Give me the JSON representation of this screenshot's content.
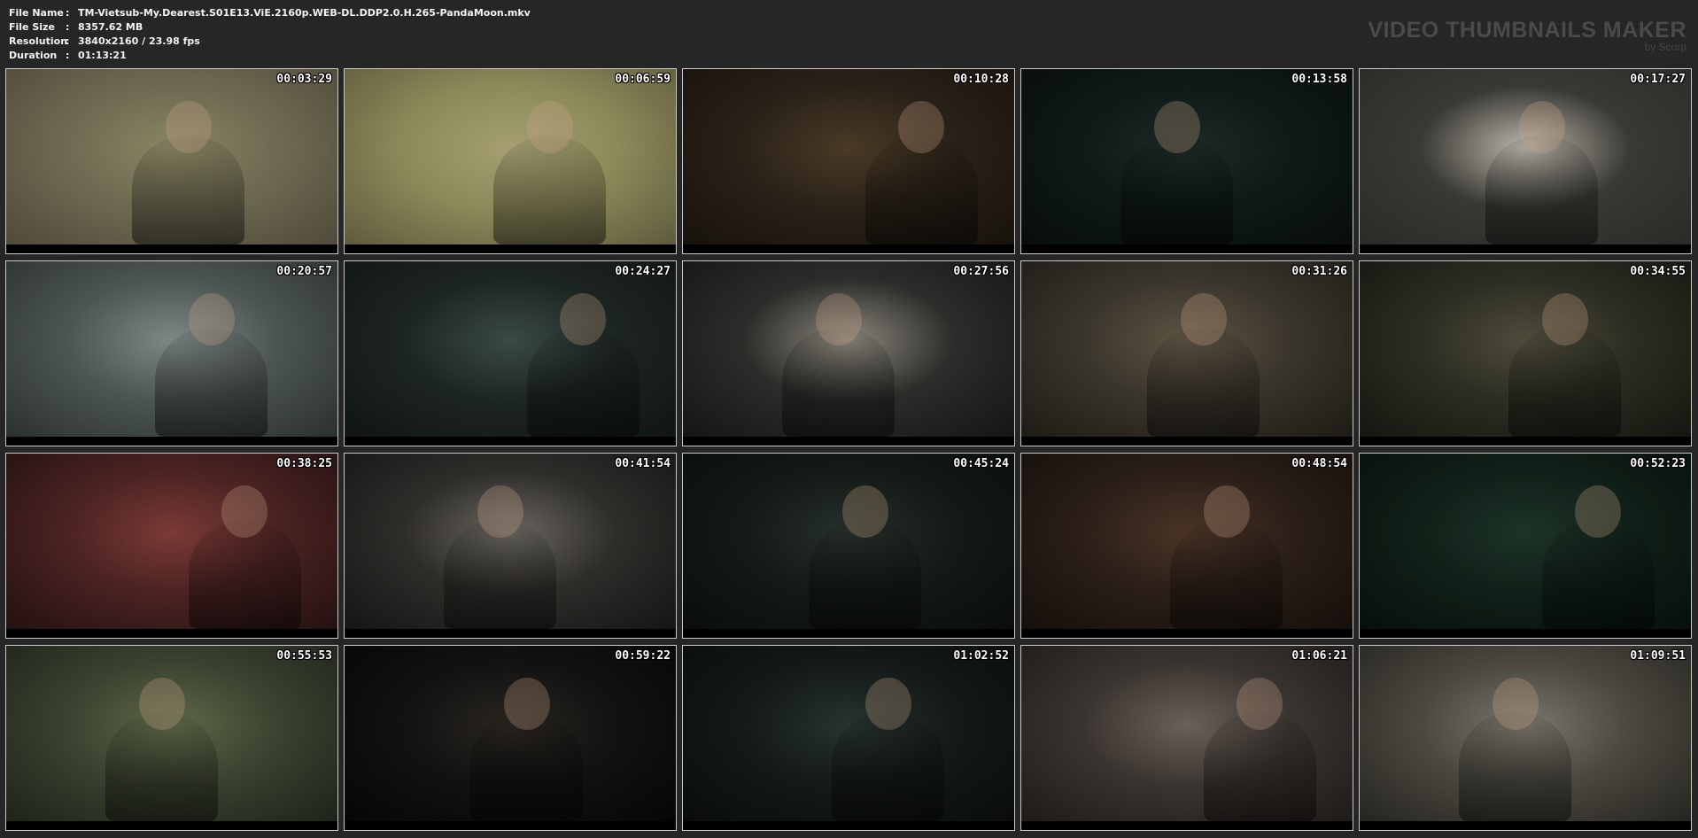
{
  "header": {
    "info": [
      {
        "label": "File Name",
        "value": "TM-Vietsub-My.Dearest.S01E13.ViE.2160p.WEB-DL.DDP2.0.H.265-PandaMoon.mkv"
      },
      {
        "label": "File Size",
        "value": "8357.62 MB"
      },
      {
        "label": "Resolution",
        "value": "3840x2160 / 23.98 fps"
      },
      {
        "label": "Duration",
        "value": "01:13:21"
      }
    ],
    "separator": ":",
    "brand_title": "VIDEO THUMBNAILS MAKER",
    "brand_sub": "by Scorp"
  },
  "thumbnails": [
    {
      "time": "00:03:29",
      "scene": "field-figures",
      "bg": [
        "#6e6a52",
        "#8a8562",
        "#4f4a3a"
      ]
    },
    {
      "time": "00:06:59",
      "scene": "old-man-reeds",
      "bg": [
        "#8d8a5a",
        "#a59f72",
        "#5e5b3d"
      ]
    },
    {
      "time": "00:10:28",
      "scene": "dark-room",
      "bg": [
        "#2a2218",
        "#4a3a26",
        "#17120c"
      ]
    },
    {
      "time": "00:13:58",
      "scene": "man-profile-dark",
      "bg": [
        "#0f1a18",
        "#1d2a26",
        "#080d0c"
      ]
    },
    {
      "time": "00:17:27",
      "scene": "woman-window",
      "bg": [
        "#3a3934",
        "#b9b5aa",
        "#2a2a27"
      ]
    },
    {
      "time": "00:20:57",
      "scene": "scholar-hat-blue",
      "bg": [
        "#4d5553",
        "#7d8784",
        "#2a312f"
      ]
    },
    {
      "time": "00:24:27",
      "scene": "scholar-close",
      "bg": [
        "#1d2522",
        "#3a4a46",
        "#101513"
      ]
    },
    {
      "time": "00:27:56",
      "scene": "black-hat-lattice",
      "bg": [
        "#2c2c2a",
        "#8c877d",
        "#151514"
      ]
    },
    {
      "time": "00:31:26",
      "scene": "woman-earrings",
      "bg": [
        "#3a352c",
        "#5f5343",
        "#1e1b16"
      ]
    },
    {
      "time": "00:34:55",
      "scene": "woman-earrings-2",
      "bg": [
        "#2c2d22",
        "#4e4b3a",
        "#161611"
      ]
    },
    {
      "time": "00:38:25",
      "scene": "scholar-red-bg",
      "bg": [
        "#4a2322",
        "#7b3a36",
        "#241111"
      ]
    },
    {
      "time": "00:41:54",
      "scene": "courtyard-gate",
      "bg": [
        "#2f2d2a",
        "#6a6760",
        "#161514"
      ]
    },
    {
      "time": "00:45:24",
      "scene": "night-house",
      "bg": [
        "#141a17",
        "#27302a",
        "#0a0d0b"
      ]
    },
    {
      "time": "00:48:54",
      "scene": "man-mustache",
      "bg": [
        "#2b1f18",
        "#4a3427",
        "#150f0b"
      ]
    },
    {
      "time": "00:52:23",
      "scene": "woman-dark-green",
      "bg": [
        "#102018",
        "#1e3328",
        "#07100b"
      ]
    },
    {
      "time": "00:55:53",
      "scene": "man-purple",
      "bg": [
        "#3b4230",
        "#5e6848",
        "#1e2318"
      ]
    },
    {
      "time": "00:59:22",
      "scene": "woman-dark-room",
      "bg": [
        "#121212",
        "#2a2620",
        "#060606"
      ]
    },
    {
      "time": "01:02:52",
      "scene": "scholar-night",
      "bg": [
        "#141a18",
        "#273230",
        "#090c0b"
      ]
    },
    {
      "time": "01:06:21",
      "scene": "wide-hat-blue",
      "bg": [
        "#3a3430",
        "#6a6058",
        "#1e1a18"
      ]
    },
    {
      "time": "01:09:51",
      "scene": "crowd-market",
      "bg": [
        "#4a4840",
        "#7a766a",
        "#26241f"
      ]
    }
  ]
}
